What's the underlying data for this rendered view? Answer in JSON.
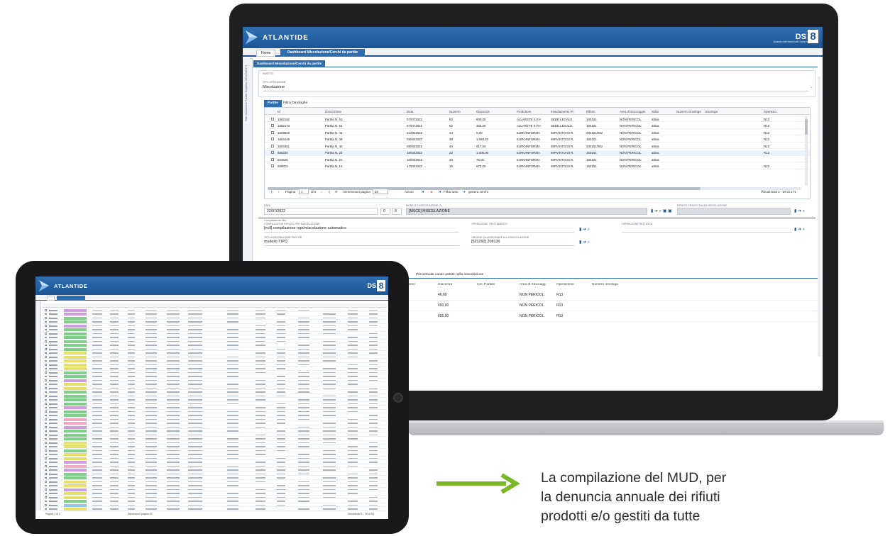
{
  "laptop_app": {
    "brand": "ATLANTIDE",
    "ds_logo": "DS",
    "ds_number": "8",
    "ds_tagline": "Quando tutti fanno tutti Come noi",
    "tabs": {
      "home": "Home",
      "active": "Dashboard Miscelazione/Cerchi da partite"
    },
    "subtab": "Dashboard Miscelazione/Cerchi da partite",
    "left_rail": "Filtri Movimenti Partite Registro MOVIMENTI",
    "form": {
      "section_label": "Partite",
      "tipo_label": "Tipo operazione",
      "tipo_value": "Miscelazione"
    },
    "inner_tabs": {
      "active": "Partite",
      "other": "Filtro Omologhe"
    },
    "grid": {
      "headers": [
        "Id",
        "Descrizione",
        "Data",
        "Numero",
        "Giacenza",
        "Produttore",
        "Insediamento Pr.",
        "Rifiuto",
        "Area di stoccaggio",
        "Stato",
        "Numero Omologa",
        "Omologa",
        "Operazio"
      ],
      "rows": [
        [
          "1692192",
          "Partita N. 63",
          "07/07/2022",
          "63",
          "600,00",
          "ALLARETE S.P.A",
          "SEDE LEGALE",
          "160101",
          "NON PERICOL.",
          "attiva",
          "",
          "",
          "R13"
        ],
        [
          "1692173",
          "Partita N. 62",
          "07/07/2022",
          "62",
          "450,00",
          "ALLARETE S.P.A",
          "SEDE LEGALE",
          "160101",
          "NON PERICOL.",
          "attiva",
          "",
          "",
          "R13"
        ],
        [
          "1629503",
          "Partita N. 44",
          "21/06/2022",
          "44",
          "0,00",
          "EUROINFORMA",
          "IMPIANTO DI R.",
          "200101/062",
          "NON PERICOL.",
          "attiva",
          "",
          "",
          "R13"
        ],
        [
          "1604446",
          "Partita N. 39",
          "09/06/2022",
          "39",
          "1.068,20",
          "EUROINFORMA",
          "IMPIANTO DI R.",
          "150101",
          "NON PERICOL.",
          "attiva",
          "",
          "",
          "R13"
        ],
        [
          "1604451",
          "Partita N. 40",
          "09/06/2022",
          "40",
          "917,60",
          "EUROINFORMA",
          "IMPIANTO DI R.",
          "200101/062",
          "NON PERICOL.",
          "attiva",
          "",
          "",
          "R13"
        ],
        [
          "556220",
          "Partita N. 22",
          "18/03/2022",
          "22",
          "1.000,00",
          "EUROINFORMA",
          "IMPIANTO DI R.",
          "150101",
          "NON PERICOL.",
          "attiva",
          "",
          "",
          "R13"
        ],
        [
          "503625",
          "Partita N. 20",
          "10/03/2022",
          "20",
          "75,00",
          "EUROINFORMA",
          "IMPIANTO DI R.",
          "150101",
          "NON PERICOL.",
          "attiva",
          "",
          "",
          ""
        ],
        [
          "559823",
          "Partita N. 16",
          "17/03/2022",
          "16",
          "673,00",
          "EUROINFORMA",
          "IMPIANTO DI R.",
          "150101",
          "NON PERICOL.",
          "attiva",
          "",
          "",
          "R13"
        ]
      ]
    },
    "pager": {
      "page_label": "Pagina",
      "page_value": "1",
      "of_label": "di 5",
      "size_label": "Dimensioni pagina",
      "size_value": "30",
      "actions_label": "Azioni",
      "filter_label": "Filtra tutto",
      "generate_label": "genera cerchi",
      "count_label": "Visualizzati 1 - 30 di 171"
    },
    "form2": {
      "data_label": "Data",
      "data_value": "22/07/2022",
      "num_a": "0",
      "num_b": "8",
      "modello_label": "Modello miscelazione (*)",
      "modello_value": "[MSCE] MISCELAZIONE",
      "rifiuto_label": "Rifiuto creato dalla miscelazione",
      "section_title": "Compilazione filtri",
      "comp_label": "Compilazione rifiuto per miscelazione",
      "comp_value": "[null] compilazione rapr/miscelazione automatico",
      "op_tratt_label": "Operazione trattamento",
      "op_rett_label": "Operazione rettifica",
      "tipo_ass_label": "Tipo assegnazione partite",
      "tipo_ass_value": "modelio TIPO",
      "origine_label": "Origine da assegnare alla miscelazione",
      "origine_value": "[521292] 208136"
    },
    "lower_tabs": {
      "second": "izione",
      "third": "Percentuale carati: partite nella miscelazione"
    },
    "lower_grid": {
      "headers": [
        "Data",
        "Numero",
        "Giacenza",
        "Cer. Partido",
        "Area di Stoccagg.",
        "Operazione",
        "Numero omologa"
      ],
      "rows": [
        [
          "21/06/2022",
          "43",
          "46,60",
          "",
          "NON PERICOL.",
          "R13",
          ""
        ],
        [
          "31/05/2022",
          "37",
          "650,00",
          "",
          "NON PERICOL.",
          "R13",
          ""
        ],
        [
          "22/06/2022",
          "42",
          "655,00",
          "",
          "NON PERICOL.",
          "R13",
          ""
        ]
      ]
    }
  },
  "tablet_app": {
    "brand": "ATLANTIDE",
    "ds_logo": "DS",
    "ds_number": "8",
    "pager_left": "Pagina  1  di 2",
    "pager_mid": "Dimensioni pagina  30",
    "pager_right": "Visualizzati 1 - 30 di 55",
    "tag_colors": [
      "#cf9ee0",
      "#7fcf8a",
      "#e6e06a",
      "#8ec9e8",
      "#f2a7c3"
    ]
  },
  "caption": {
    "lines": [
      "La compilazione del MUD, per",
      "la denuncia annuale dei rifiuti",
      "prodotti e/o gestiti da tutte"
    ]
  },
  "colors": {
    "accent_blue": "#1d5596",
    "arrow_green": "#7ab828",
    "device_frame": "#1f1f21"
  }
}
